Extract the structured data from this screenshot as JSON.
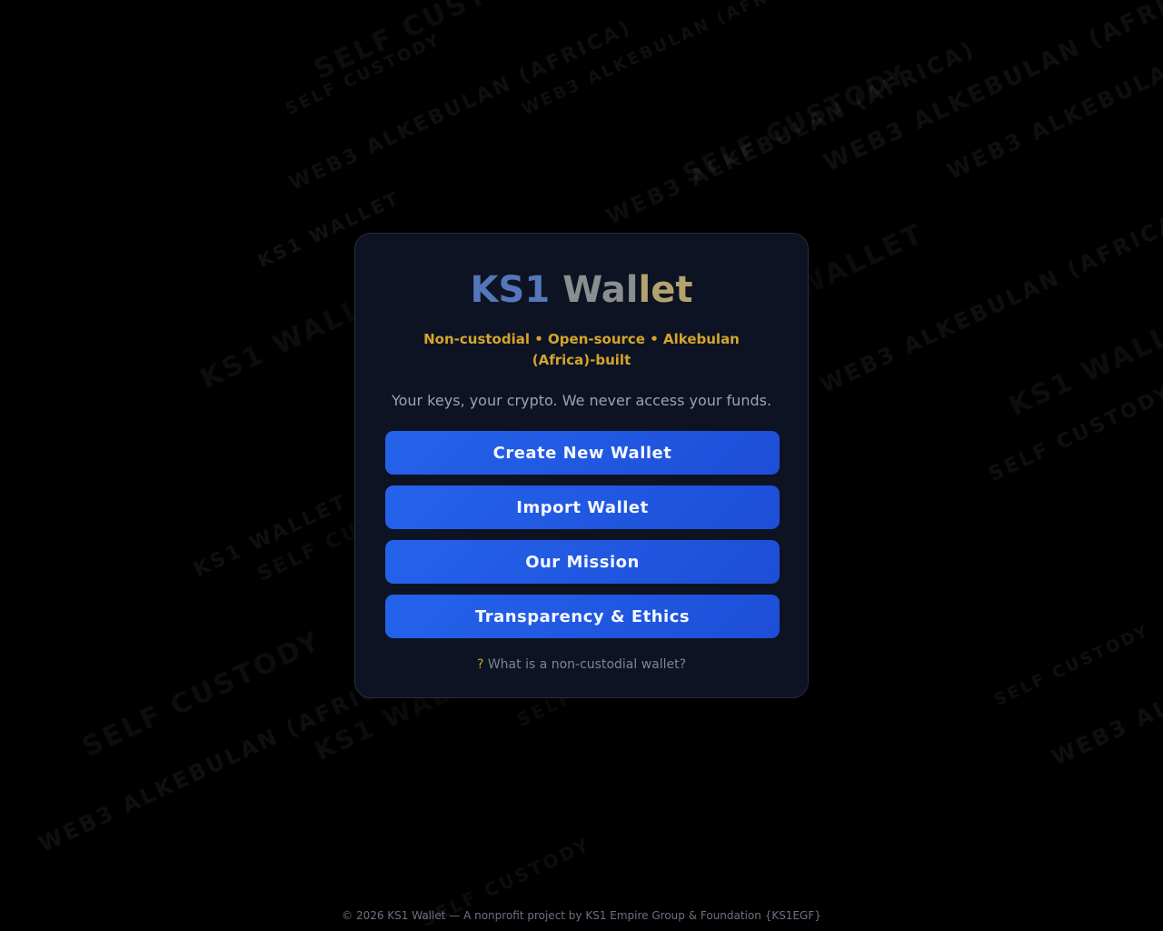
{
  "app": {
    "title_part1": "KS1",
    "title_part2": "Wal",
    "title_part3": "let",
    "tagline": "Non-custodial • Open-source • Alkebulan (Africa)-built",
    "subtitle": "Your keys, your crypto. We never access your funds."
  },
  "actions": [
    {
      "label": "Create New Wallet"
    },
    {
      "label": "Import Wallet"
    },
    {
      "label": "Our Mission"
    },
    {
      "label": "Transparency & Ethics"
    }
  ],
  "help": {
    "icon": "?",
    "link_text": "What is a non-custodial wallet?"
  },
  "footer": {
    "text": "© 2026 KS1 Wallet — A nonprofit project by KS1 Empire Group & Foundation {KS1EGF}"
  },
  "watermarks": [
    "SELF CUSTODY",
    "SELF CUSTODY",
    "WEB3 ALKEBULAN (AFRICA)",
    "WEB3 ALKEBULAN (AFRICA)",
    "KS1 WALLET",
    "WEB3 ALKEBULAN (AFRICA)",
    "SELF CUSTODY",
    "WEB3 ALKEBULAN (AFRICA)",
    "WEB3 ALKEBULAN (AFRICA)",
    "KS1 WALLET",
    "WALLET",
    "WEB3 ALKEBULAN (AFRICA)",
    "KS1 WALLET",
    "SELF CUSTODY",
    "KS1 WALLET",
    "SELF CUSTODY",
    "SELF CUSTODY",
    "WEB3 ALKEBULAN (AFRICA)",
    "KS1 WALLET",
    "SELF CUSTODY",
    "WEB3 ALKEBULAN (AFRICA)",
    "SELF CUSTODY",
    "SELF CUSTODY"
  ],
  "colors": {
    "background": "#000000",
    "card": "#0d1322",
    "accent_gold": "#d4a52b",
    "button_blue": "#2563eb"
  }
}
